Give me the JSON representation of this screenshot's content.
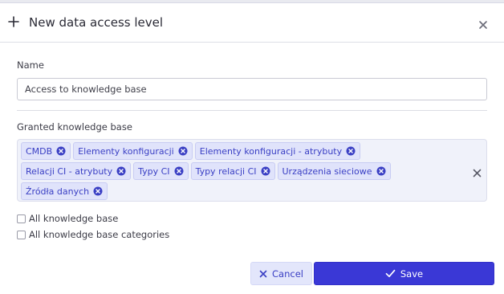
{
  "dialog": {
    "title": "New data access level",
    "icons": {
      "add": "plus-icon",
      "close": "close-icon"
    }
  },
  "form": {
    "name_label": "Name",
    "name_value": "Access to knowledge base",
    "granted_label": "Granted knowledge base",
    "granted_items": [
      "CMDB",
      "Elementy konfiguracji",
      "Elementy konfiguracji - atrybuty",
      "Relacji CI - atrybuty",
      "Typy CI",
      "Typy relacji CI",
      "Urządzenia sieciowe",
      "Źródła danych"
    ],
    "all_knowledge_base_label": "All knowledge base",
    "all_knowledge_base_checked": false,
    "all_categories_label": "All knowledge base categories",
    "all_categories_checked": false
  },
  "actions": {
    "cancel_label": "Cancel",
    "save_label": "Save"
  },
  "colors": {
    "accent": "#3a38d6",
    "chip_bg": "#e0e3fb",
    "chip_text": "#3a3fc4"
  }
}
